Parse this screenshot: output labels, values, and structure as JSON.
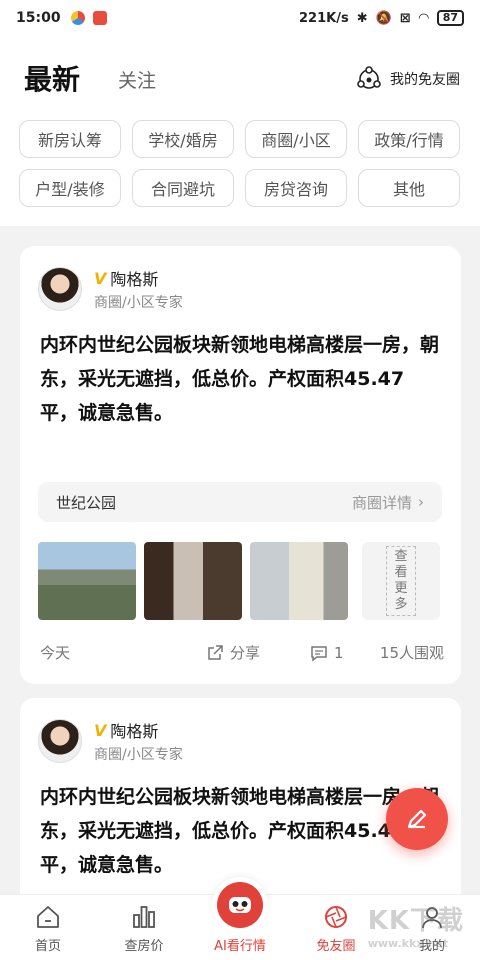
{
  "status_bar": {
    "time": "15:00",
    "speed": "221K/s",
    "battery": "87"
  },
  "header": {
    "tab_latest": "最新",
    "tab_follow": "关注",
    "circle_link": "我的免友圈"
  },
  "chips": [
    "新房认筹",
    "学校/婚房",
    "商圈/小区",
    "政策/行情",
    "户型/装修",
    "合同避坑",
    "房贷咨询",
    "其他"
  ],
  "posts": [
    {
      "author": "陶格斯",
      "badge": "V",
      "role": "商圈/小区专家",
      "text": "内环内世纪公园板块新领地电梯高楼层一房，朝东，采光无遮挡，低总价。产权面积45.47平，诚意急售。",
      "area_name": "世纪公园",
      "area_detail": "商圈详情",
      "more_photos": "查看更多",
      "time": "今天",
      "share": "分享",
      "comments": "1",
      "views": "15人围观"
    },
    {
      "author": "陶格斯",
      "badge": "V",
      "role": "商圈/小区专家",
      "text": "内环内世纪公园板块新领地电梯高楼层一房，朝东，采光无遮挡，低总价。产权面积45.47平，诚意急售。"
    }
  ],
  "nav": {
    "home": "首页",
    "price": "查房价",
    "ai": "AI看行情",
    "circle": "免友圈",
    "mine": "我的"
  },
  "watermark": {
    "main": "KK下载",
    "url": "www.kkx.net"
  },
  "colors": {
    "accent": "#e0413a",
    "badge": "#f0b400"
  }
}
